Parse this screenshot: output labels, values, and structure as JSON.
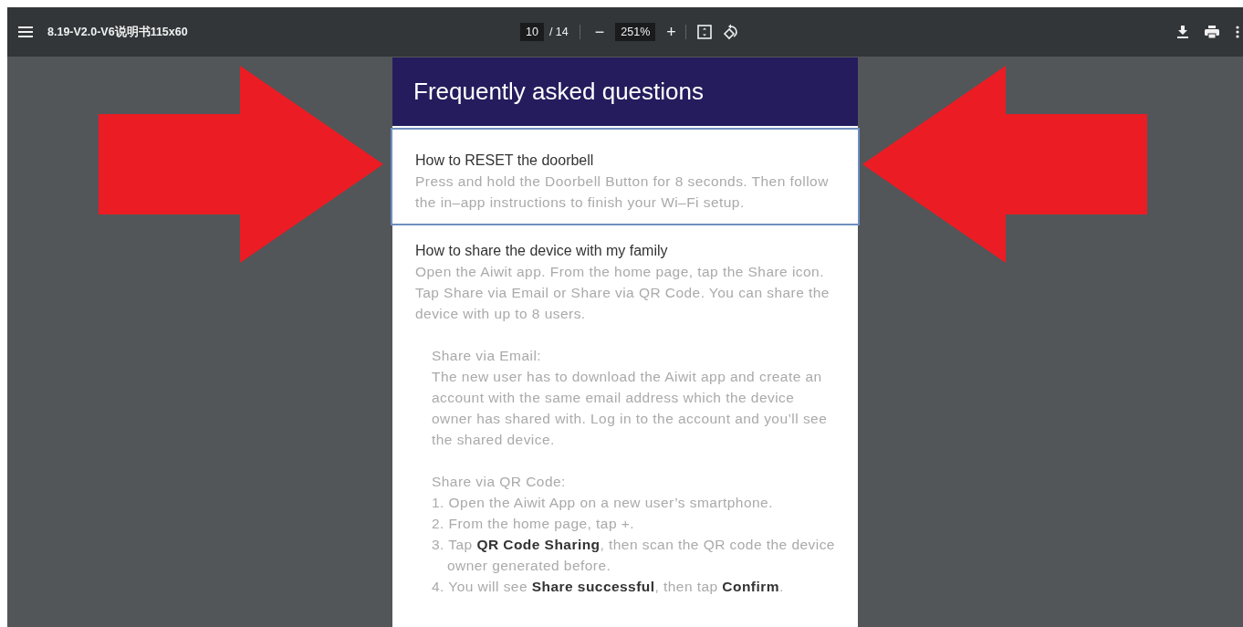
{
  "toolbar": {
    "title": "8.19-V2.0-V6说明书115x60",
    "page_current": "10",
    "page_count": "/ 14",
    "zoom_out": "−",
    "zoom": "251%",
    "zoom_in": "+"
  },
  "document": {
    "heading": "Frequently asked questions",
    "faqs": [
      {
        "question": "How to RESET the doorbell",
        "answer": "Press and hold the Doorbell Button for 8 seconds. Then follow the in–app instructions to finish your Wi–Fi setup.",
        "highlighted": true
      },
      {
        "question": "How to share the device with my family",
        "answer": "Open the Aiwit app. From the home page, tap the Share icon. Tap Share via Email or Share via QR Code. You can share the device with up to 8 users.",
        "highlighted": false,
        "sections": [
          {
            "title": "Share via Email:",
            "text": "The new user has to download the Aiwit app and create an account with the same email address which the device owner has shared with. Log in to the account and you’ll see the shared device."
          },
          {
            "title": "Share via QR Code:",
            "steps": [
              "1. Open the Aiwit App on a new user’s smartphone.",
              "2. From the home page, tap +.",
              "3. Tap **QR Code Sharing**, then scan the QR code the device owner generated before.",
              "4. You will see **Share successful**, then tap **Confirm**."
            ]
          }
        ]
      }
    ]
  },
  "annotations": [
    {
      "kind": "arrow-right"
    },
    {
      "kind": "arrow-left"
    }
  ]
}
